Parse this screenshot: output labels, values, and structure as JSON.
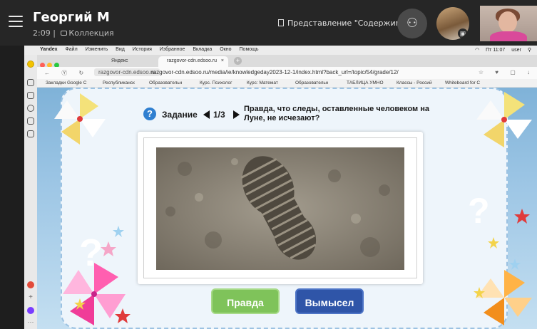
{
  "call": {
    "caller_name": "Георгий М",
    "elapsed": "2:09",
    "collection_label": "Коллекция",
    "presentation_label": "Представление \"Содержимое\"",
    "accent": "#262626"
  },
  "mac_menu": {
    "app": "Yandex",
    "items": [
      "Файл",
      "Изменить",
      "Вид",
      "История",
      "Избранное",
      "Вкладка",
      "Окно",
      "Помощь"
    ],
    "clock": "Пт 11:07",
    "user": "user"
  },
  "browser": {
    "tabs": [
      {
        "label": "Яндекс"
      },
      {
        "label": "razgovor-cdn.edsoo.ru"
      }
    ],
    "url_domain": "razgovor-cdn.edsoo.ru",
    "url_full": "razgovor-cdn.edsoo.ru/media/ie/knowledgeday2023-12-1/index.html?back_url=/topic/54/grade/12/",
    "bookmarks": [
      "Закладки Google C",
      "Республиканск",
      "Образовательн",
      "Курс. Психолог",
      "Курс: Математ",
      "Образовательн",
      "ТАБЛИЦА УМНО",
      "Классы - Россий",
      "Whiteboard for C"
    ]
  },
  "quiz": {
    "task_label": "Задание",
    "counter": "1/3",
    "question": "Правда, что следы, оставленные человеком на Луне, не исчезают?",
    "true_label": "Правда",
    "false_label": "Вымысел",
    "true_color": "#7fc35a",
    "false_color": "#2f55a8"
  }
}
